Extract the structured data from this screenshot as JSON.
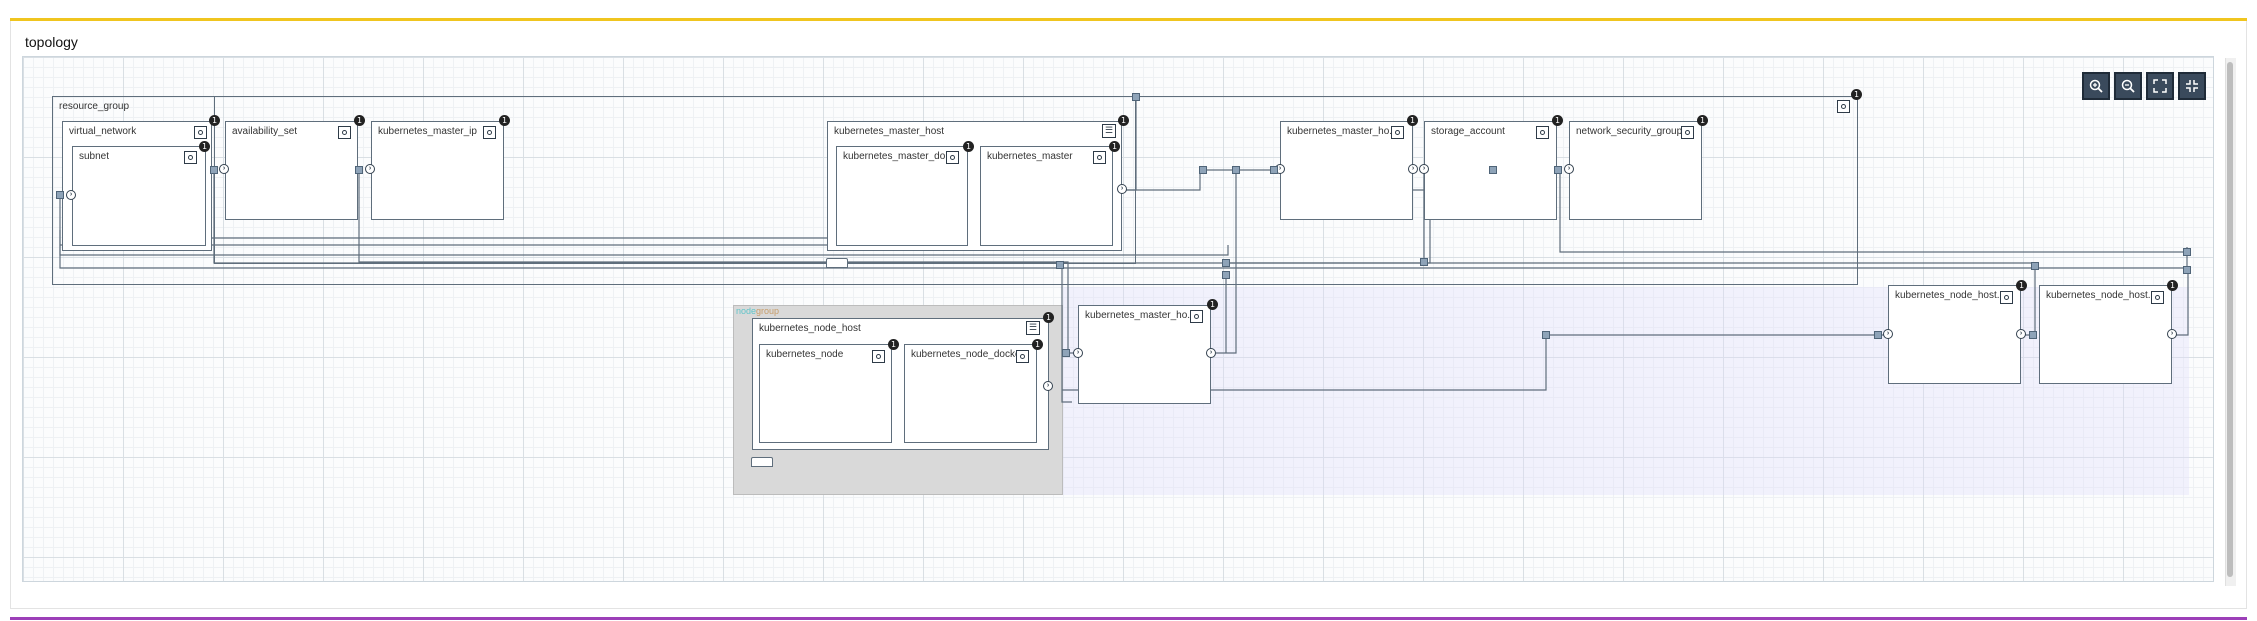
{
  "panel": {
    "title": "topology"
  },
  "toolbar": {
    "zoom_in": "zoom-in-icon",
    "zoom_out": "zoom-out-icon",
    "fit": "fit-icon",
    "actual_size": "actual-size-icon"
  },
  "group": {
    "label_a": "node",
    "label_b": "group"
  },
  "nodes": {
    "resource_group": "resource_group",
    "virtual_network": "virtual_network",
    "subnet": "subnet",
    "availability_set": "availability_set",
    "kubernetes_master_ip": "kubernetes_master_ip",
    "kubernetes_master_host": "kubernetes_master_host",
    "kubernetes_master_docker": "kubernetes_master_do...",
    "kubernetes_master": "kubernetes_master",
    "kubernetes_master_host_nic": "kubernetes_master_ho...",
    "storage_account": "storage_account",
    "network_security_group": "network_security_group",
    "kubernetes_node_host": "kubernetes_node_host",
    "kubernetes_node": "kubernetes_node",
    "kubernetes_node_docker": "kubernetes_node_docker",
    "kubernetes_master_host_nic2": "kubernetes_master_ho...",
    "kubernetes_node_host_a": "kubernetes_node_host...",
    "kubernetes_node_host_b": "kubernetes_node_host..."
  },
  "badge": "1",
  "colors": {
    "top_bar": "#f0c51f",
    "bottom_bar": "#9c3fb8",
    "node_border": "#5f6e7c",
    "badge": "#222222"
  }
}
